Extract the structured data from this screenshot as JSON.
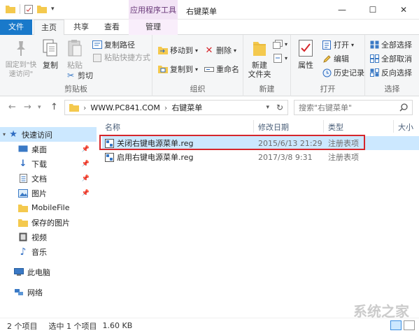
{
  "title_bar": {
    "context_tab_label": "应用程序工具",
    "window_title": "右键菜单"
  },
  "ribbon_tabs": [
    "文件",
    "主页",
    "共享",
    "查看",
    "管理"
  ],
  "ribbon": {
    "clipboard": {
      "pin_label": "固定到\"快速访问\"",
      "copy_label": "复制",
      "paste_label": "粘贴",
      "copy_path_label": "复制路径",
      "paste_shortcut_label": "粘贴快捷方式",
      "cut_label": "剪切",
      "group_label": "剪贴板"
    },
    "organize": {
      "move_to_label": "移动到",
      "copy_to_label": "复制到",
      "delete_label": "删除",
      "rename_label": "重命名",
      "group_label": "组织"
    },
    "new": {
      "new_folder_label": "新建\n文件夹",
      "group_label": "新建"
    },
    "open": {
      "properties_label": "属性",
      "open_label": "打开",
      "edit_label": "编辑",
      "history_label": "历史记录",
      "group_label": "打开"
    },
    "select": {
      "select_all_label": "全部选择",
      "select_none_label": "全部取消",
      "invert_label": "反向选择",
      "group_label": "选择"
    }
  },
  "address": {
    "segments": [
      "WWW.PC841.COM",
      "右键菜单"
    ],
    "search_placeholder": "搜索\"右键菜单\""
  },
  "nav_pane": {
    "quick_access": "快速访问",
    "items": [
      "桌面",
      "下载",
      "文档",
      "图片",
      "MobileFile",
      "保存的图片",
      "视频",
      "音乐"
    ],
    "this_pc": "此电脑",
    "network": "网络"
  },
  "file_list": {
    "columns": [
      "名称",
      "修改日期",
      "类型",
      "大小"
    ],
    "rows": [
      {
        "name": "关闭右键电源菜单.reg",
        "date": "2015/6/13 21:29",
        "type": "注册表项"
      },
      {
        "name": "启用右键电源菜单.reg",
        "date": "2017/3/8 9:31",
        "type": "注册表项"
      }
    ]
  },
  "status": {
    "item_count": "2 个项目",
    "selected": "选中 1 个项目",
    "size": "1.60 KB"
  },
  "watermark": "系统之家",
  "colors": {
    "file_tab": "#1979ca",
    "selection": "#cce8ff",
    "highlight_border": "#d6262b",
    "context_tab": "#f3e4f6"
  }
}
